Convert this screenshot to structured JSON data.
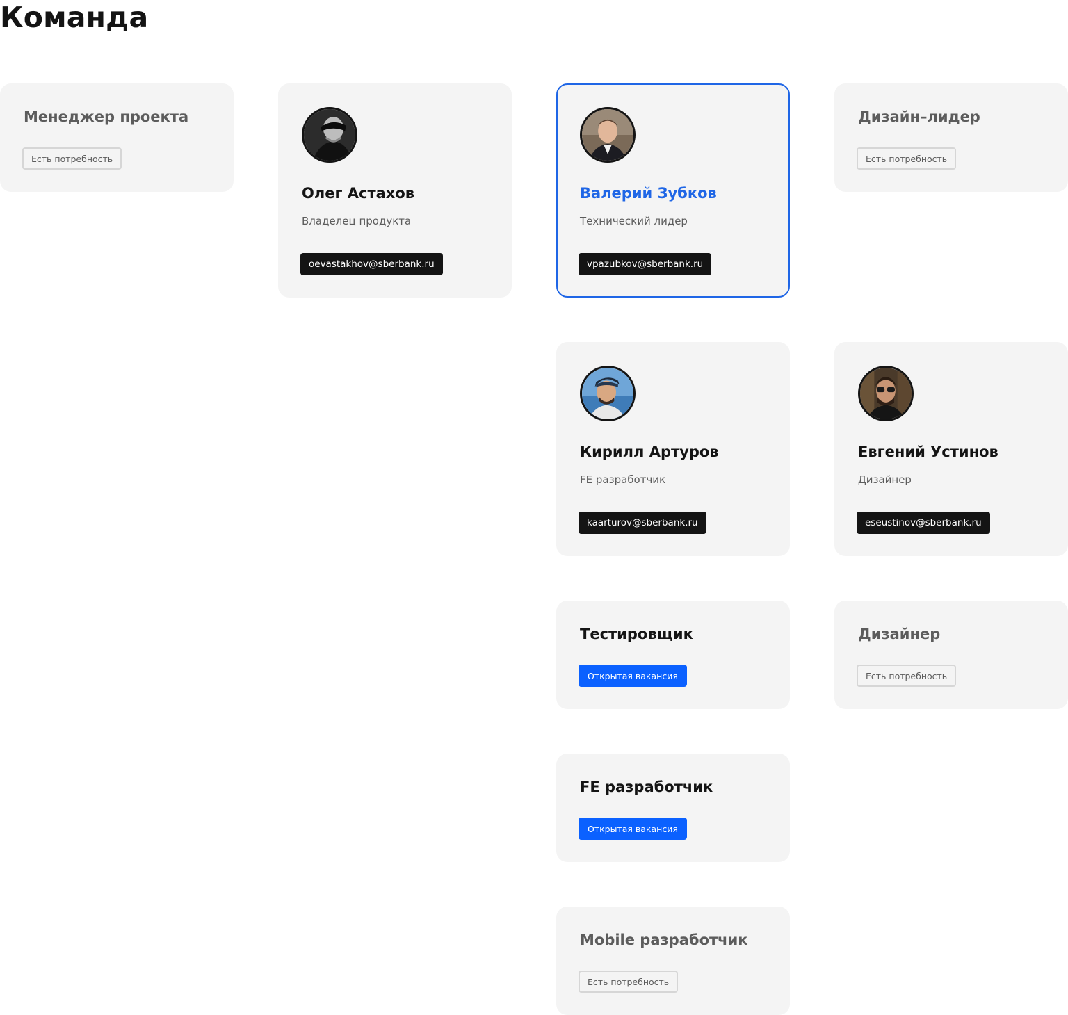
{
  "page": {
    "title": "Команда"
  },
  "colors": {
    "accent": "#1f66e6",
    "open_badge": "#0b61ff",
    "card_bg": "#f4f4f4",
    "email_badge": "#141414"
  },
  "vacancies": {
    "project_manager": {
      "title": "Менеджер проекта",
      "status": "Есть потребность"
    },
    "design_lead": {
      "title": "Дизайн–лидер",
      "status": "Есть потребность"
    },
    "tester": {
      "title": "Тестировщик",
      "status": "Открытая вакансия"
    },
    "designer": {
      "title": "Дизайнер",
      "status": "Есть потребность"
    },
    "fe_developer": {
      "title": "FE разработчик",
      "status": "Открытая вакансия"
    },
    "mobile_developer": {
      "title": "Mobile разработчик",
      "status": "Есть потребность"
    }
  },
  "members": {
    "oleg": {
      "name": "Олег Астахов",
      "role": "Владелец продукта",
      "email": "oevastakhov@sberbank.ru",
      "avatar_icon": "avatar-icon"
    },
    "valeriy": {
      "name": "Валерий Зубков",
      "role": "Технический лидер",
      "email": "vpazubkov@sberbank.ru",
      "avatar_icon": "avatar-icon"
    },
    "kirill": {
      "name": "Кирилл Артуров",
      "role": "FE разработчик",
      "email": "kaarturov@sberbank.ru",
      "avatar_icon": "avatar-icon"
    },
    "evgeniy": {
      "name": "Евгений Устинов",
      "role": "Дизайнер",
      "email": "eseustinov@sberbank.ru",
      "avatar_icon": "avatar-icon"
    }
  }
}
